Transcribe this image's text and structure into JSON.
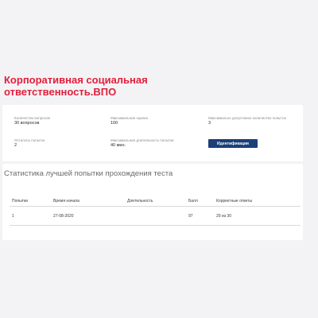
{
  "title": "Корпоративная социальная ответственность.ВПО",
  "info": {
    "questions_label": "Количество вопросов",
    "questions_value": "30 вопросов",
    "max_score_label": "Максимальная оценка",
    "max_score_value": "100",
    "max_attempts_label": "Максимально допустимое количество попыток",
    "max_attempts_value": "3",
    "remaining_label": "Осталось попыток",
    "remaining_value": "2",
    "max_duration_label": "Максимальная длительность попытки",
    "max_duration_value": "40 мин.",
    "identify_button": "Идентификация"
  },
  "stats": {
    "title": "Статистика лучшей попытки прохождения теста",
    "columns": [
      "Попытки",
      "Время начала",
      "Длительность",
      "Балл",
      "Корректные ответы"
    ],
    "rows": [
      [
        "1",
        "27-08-2020",
        "",
        "97",
        "29 из 30"
      ]
    ]
  },
  "colors": {
    "title": "#e31e3c",
    "button": "#1b3f78",
    "background": "#f3f3f5"
  }
}
